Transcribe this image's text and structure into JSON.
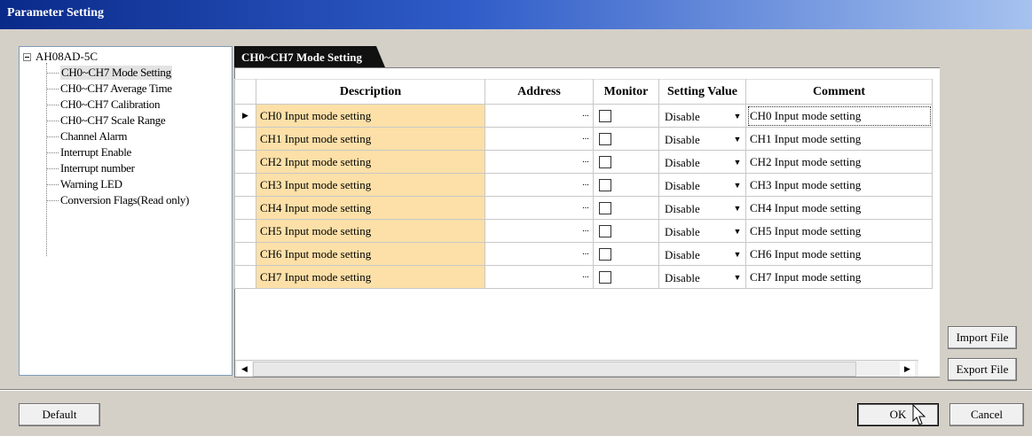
{
  "window": {
    "title": "Parameter Setting"
  },
  "tree": {
    "root": "AH08AD-5C",
    "items": [
      "CH0~CH7 Mode Setting",
      "CH0~CH7 Average Time",
      "CH0~CH7 Calibration",
      "CH0~CH7 Scale Range",
      "Channel Alarm",
      "Interrupt Enable",
      "Interrupt number",
      "Warning LED",
      "Conversion Flags(Read only)"
    ],
    "selected_index": 0
  },
  "section": {
    "title": "CH0~CH7 Mode Setting"
  },
  "grid": {
    "columns": [
      "Description",
      "Address",
      "Monitor",
      "Setting Value",
      "Comment"
    ],
    "rows": [
      {
        "description": "CH0 Input mode setting",
        "address": "",
        "monitor": false,
        "setting_value": "Disable",
        "comment": "CH0 Input mode setting"
      },
      {
        "description": "CH1 Input mode setting",
        "address": "",
        "monitor": false,
        "setting_value": "Disable",
        "comment": "CH1 Input mode setting"
      },
      {
        "description": "CH2 Input mode setting",
        "address": "",
        "monitor": false,
        "setting_value": "Disable",
        "comment": "CH2 Input mode setting"
      },
      {
        "description": "CH3 Input mode setting",
        "address": "",
        "monitor": false,
        "setting_value": "Disable",
        "comment": "CH3 Input mode setting"
      },
      {
        "description": "CH4 Input mode setting",
        "address": "",
        "monitor": false,
        "setting_value": "Disable",
        "comment": "CH4 Input mode setting"
      },
      {
        "description": "CH5 Input mode setting",
        "address": "",
        "monitor": false,
        "setting_value": "Disable",
        "comment": "CH5 Input mode setting"
      },
      {
        "description": "CH6 Input mode setting",
        "address": "",
        "monitor": false,
        "setting_value": "Disable",
        "comment": "CH6 Input mode setting"
      },
      {
        "description": "CH7 Input mode setting",
        "address": "",
        "monitor": false,
        "setting_value": "Disable",
        "comment": "CH7 Input mode setting"
      }
    ],
    "current_row": 0,
    "ellipsis_label": "...",
    "row_indicator": "▶"
  },
  "buttons": {
    "import_file": "Import File",
    "export_file": "Export File",
    "default": "Default",
    "ok": "OK",
    "cancel": "Cancel"
  },
  "colors": {
    "title_gradient_start": "#0a2a8a",
    "title_gradient_end": "#a6c2ef",
    "description_cell": "#fce0a8",
    "dialog_background": "#d4d0c8"
  }
}
